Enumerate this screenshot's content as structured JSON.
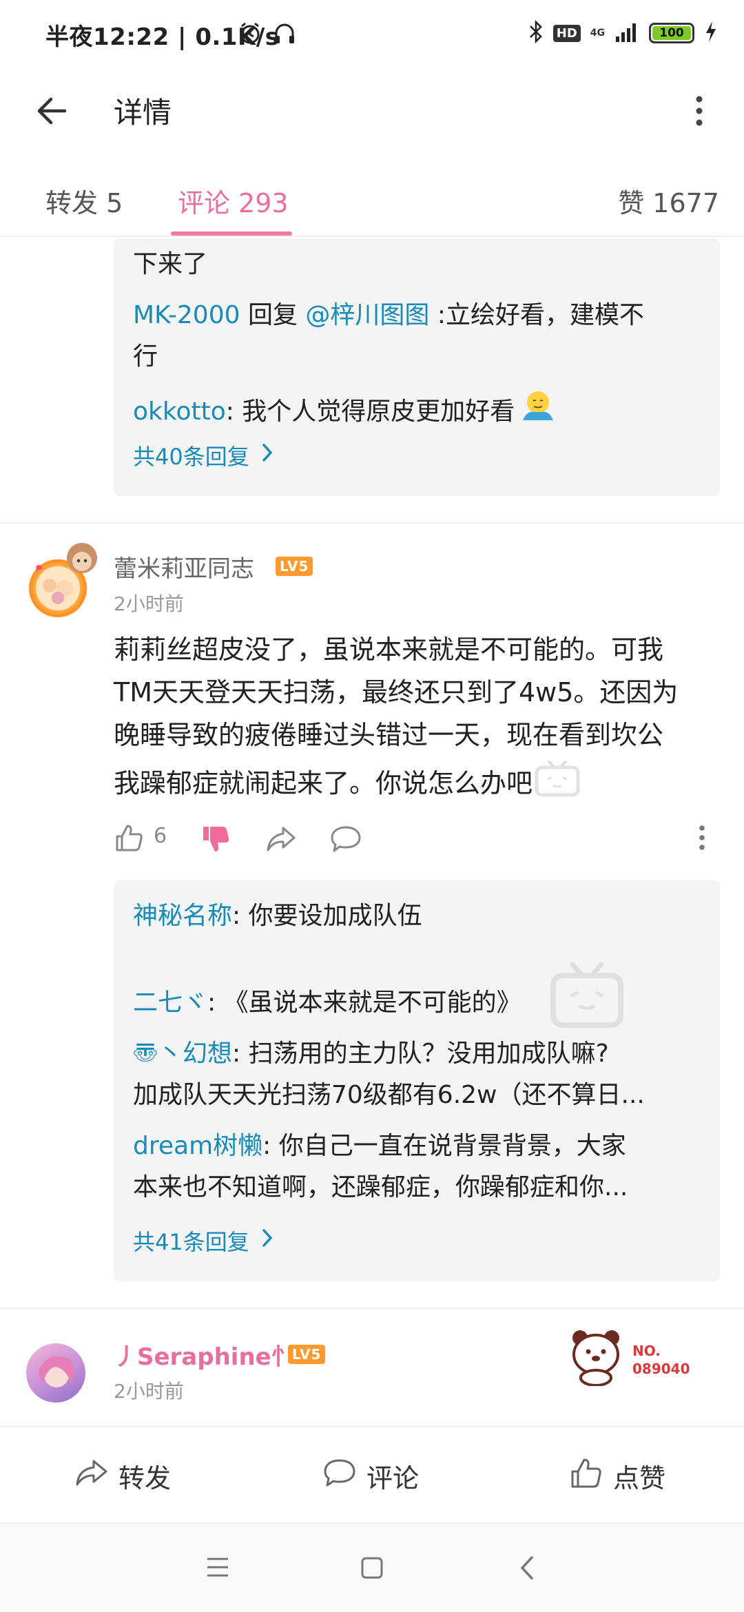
{
  "status_bar": {
    "time": "半夜12:22 | 0.1K/s",
    "hd": "HD",
    "network": "4G",
    "battery": "100"
  },
  "header": {
    "title": "详情"
  },
  "tabs": {
    "repost": "转发 5",
    "comments": "评论 293",
    "likes": "赞 1677"
  },
  "thread1": {
    "partial_text": "下来了",
    "replies": [
      {
        "user": "MK-2000",
        "reply_word": " 回复 ",
        "mention": "@梓川图图",
        "text_line1": " :立绘好看，建模不",
        "text_line2": "行"
      },
      {
        "user": "okkotto",
        "text": ": 我个人觉得原皮更加好看 "
      }
    ],
    "more": "共40条回复"
  },
  "comment": {
    "user": "蕾米莉亚同志",
    "level": "LV5",
    "time": "2小时前",
    "body": [
      "莉莉丝超皮没了，虽说本来就是不可能的。可我",
      "TM天天登天天扫荡，最终还只到了4w5。还因为",
      "晚睡导致的疲倦睡过头错过一天，现在看到坎公",
      "我躁郁症就闹起来了。你说怎么办吧"
    ],
    "like_count": "6",
    "replies": [
      {
        "user": "神秘名称",
        "text": ": 你要设加成队伍"
      },
      {
        "user": "二七ヾ",
        "text": ": 《虽说本来就是不可能的》"
      },
      {
        "user": "〠丶幻想",
        "text": ": 扫荡用的主力队？没用加成队嘛?",
        "text2": "加成队天天光扫荡70级都有6.2w（还不算日..."
      },
      {
        "user": "dream树懒",
        "text": ": 你自己一直在说背景背景，大家",
        "text2": "本来也不知道啊，还躁郁症，你躁郁症和你..."
      }
    ],
    "more": "共41条回复"
  },
  "comment2": {
    "user": "丿Seraphine忄",
    "level": "LV5",
    "time": "2小时前",
    "badge_no": "NO.",
    "badge_num": "089040"
  },
  "bottom_bar": {
    "repost": "转发",
    "comment": "评论",
    "like": "点赞"
  },
  "colors": {
    "accent_pink": "#e86f9c",
    "link_blue": "#178bb8",
    "level_orange": "#ff9a2e"
  }
}
